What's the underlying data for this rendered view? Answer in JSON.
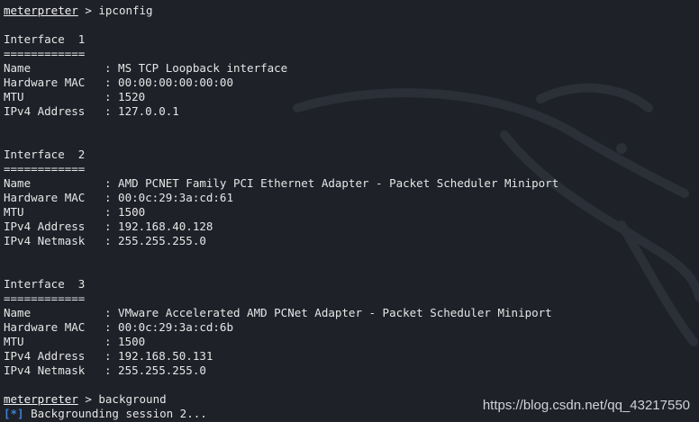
{
  "terminal": {
    "prompt": "meterpreter",
    "command1": " > ipconfig",
    "separator": "============",
    "interfaces": [
      {
        "header": "Interface  1",
        "rows": [
          {
            "key": "Name",
            "value": ": MS TCP Loopback interface"
          },
          {
            "key": "Hardware MAC",
            "value": ": 00:00:00:00:00:00"
          },
          {
            "key": "MTU",
            "value": ": 1520"
          },
          {
            "key": "IPv4 Address",
            "value": ": 127.0.0.1"
          }
        ]
      },
      {
        "header": "Interface  2",
        "rows": [
          {
            "key": "Name",
            "value": ": AMD PCNET Family PCI Ethernet Adapter - Packet Scheduler Miniport"
          },
          {
            "key": "Hardware MAC",
            "value": ": 00:0c:29:3a:cd:61"
          },
          {
            "key": "MTU",
            "value": ": 1500"
          },
          {
            "key": "IPv4 Address",
            "value": ": 192.168.40.128"
          },
          {
            "key": "IPv4 Netmask",
            "value": ": 255.255.255.0"
          }
        ]
      },
      {
        "header": "Interface  3",
        "rows": [
          {
            "key": "Name",
            "value": ": VMware Accelerated AMD PCNet Adapter - Packet Scheduler Miniport"
          },
          {
            "key": "Hardware MAC",
            "value": ": 00:0c:29:3a:cd:6b"
          },
          {
            "key": "MTU",
            "value": ": 1500"
          },
          {
            "key": "IPv4 Address",
            "value": ": 192.168.50.131"
          },
          {
            "key": "IPv4 Netmask",
            "value": ": 255.255.255.0"
          }
        ]
      }
    ],
    "command2": " > background",
    "status_marker": "[*]",
    "status_text": " Backgrounding session 2..."
  },
  "watermark": "https://blog.csdn.net/qq_43217550",
  "icons": {
    "background": "kali-dragon-icon"
  }
}
